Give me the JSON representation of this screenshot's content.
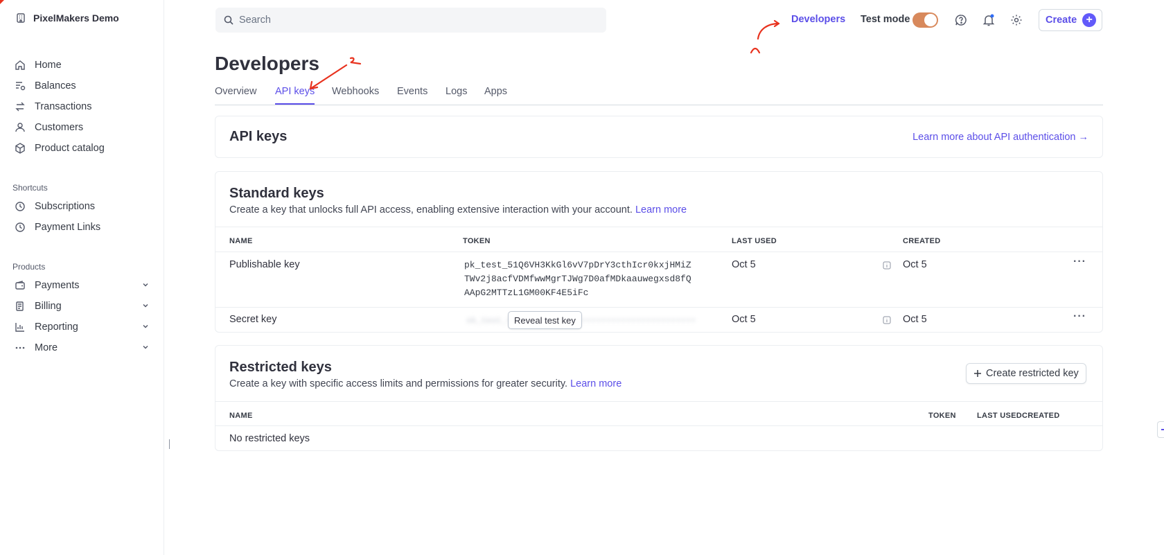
{
  "sidebar": {
    "account_name": "PixelMakers Demo",
    "items": [
      {
        "label": "Home",
        "icon": "home-icon"
      },
      {
        "label": "Balances",
        "icon": "balances-icon"
      },
      {
        "label": "Transactions",
        "icon": "transactions-icon"
      },
      {
        "label": "Customers",
        "icon": "user-icon"
      },
      {
        "label": "Product catalog",
        "icon": "box-icon"
      }
    ],
    "shortcuts_title": "Shortcuts",
    "shortcuts": [
      {
        "label": "Subscriptions",
        "icon": "clock-icon"
      },
      {
        "label": "Payment Links",
        "icon": "clock-icon"
      }
    ],
    "products_title": "Products",
    "products": [
      {
        "label": "Payments",
        "icon": "wallet-icon"
      },
      {
        "label": "Billing",
        "icon": "billing-icon"
      },
      {
        "label": "Reporting",
        "icon": "reporting-icon"
      },
      {
        "label": "More",
        "icon": "more-dots-icon"
      }
    ]
  },
  "topbar": {
    "search_placeholder": "Search",
    "developers_label": "Developers",
    "test_mode_label": "Test mode",
    "test_mode_on": true,
    "create_label": "Create"
  },
  "page": {
    "title": "Developers",
    "tabs": [
      "Overview",
      "API keys",
      "Webhooks",
      "Events",
      "Logs",
      "Apps"
    ],
    "active_tab": "API keys"
  },
  "api_keys_card": {
    "title": "API keys",
    "link": "Learn more about API authentication →"
  },
  "standard_keys": {
    "title": "Standard keys",
    "description": "Create a key that unlocks full API access, enabling extensive interaction with your account.",
    "learn_more": "Learn more",
    "columns": [
      "NAME",
      "TOKEN",
      "LAST USED",
      "CREATED"
    ],
    "rows": [
      {
        "name": "Publishable key",
        "token_lines": [
          "pk_test_51Q6VH3KkGl6vV7pDrY3cthIcr0kxjHMiZ",
          "TWv2j8acfVDMfwwMgrTJWg7D0afMDkaauwegxsd8fQ",
          "AApG2MTTzL1GM00KF4E5iFc"
        ],
        "last_used": "Oct 5",
        "created": "Oct 5"
      },
      {
        "name": "Secret key",
        "reveal_label": "Reveal test key",
        "last_used": "Oct 5",
        "created": "Oct 5"
      }
    ]
  },
  "restricted_keys": {
    "title": "Restricted keys",
    "description": "Create a key with specific access limits and permissions for greater security.",
    "learn_more": "Learn more",
    "create_button": "Create restricted key",
    "columns": [
      "NAME",
      "TOKEN",
      "LAST USED",
      "CREATED"
    ],
    "empty_text": "No restricted keys"
  },
  "colors": {
    "accent": "#5b4ee8",
    "toggle": "#d8895c",
    "annotation": "#e8321e"
  }
}
